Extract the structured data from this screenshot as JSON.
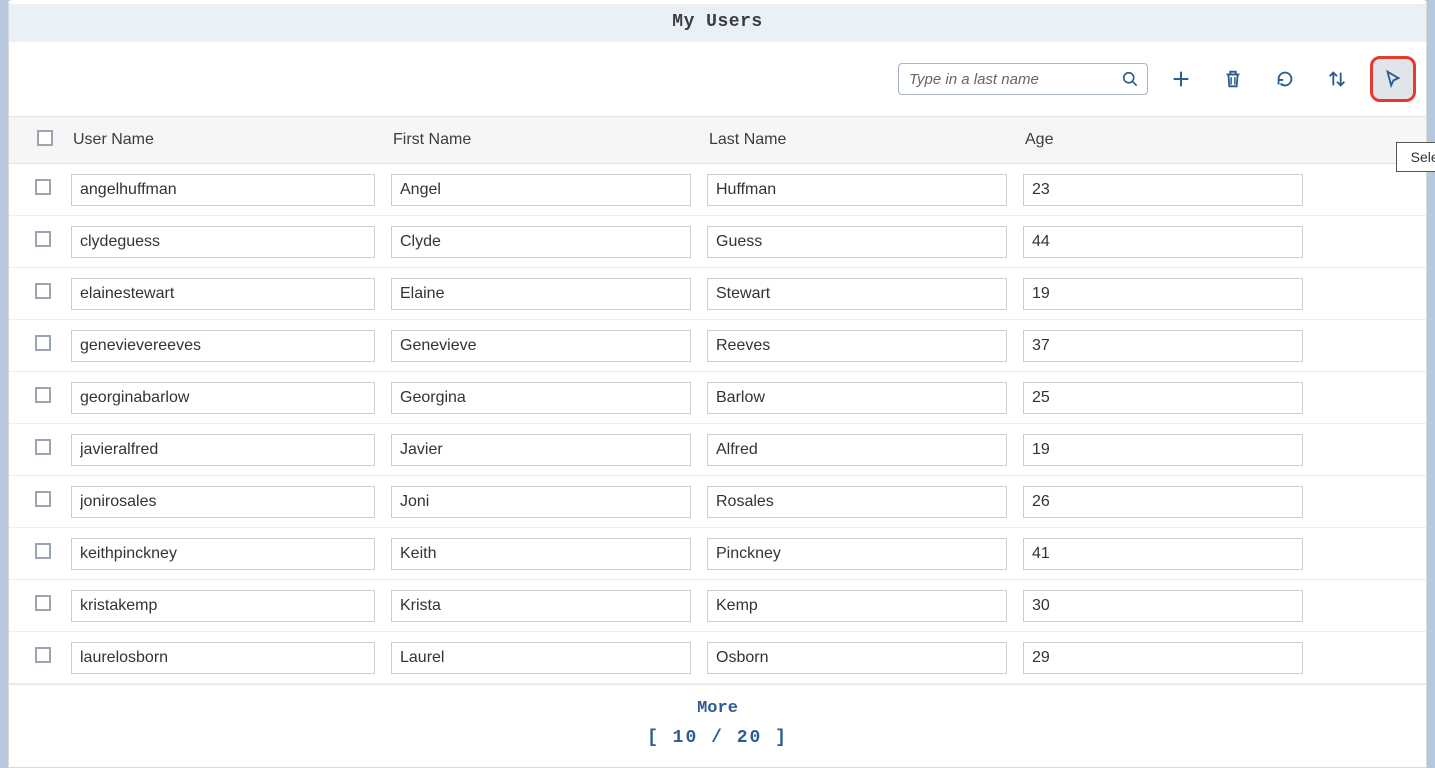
{
  "title": "My Users",
  "search": {
    "placeholder": "Type in a last name"
  },
  "tooltip": "Select User",
  "columns": {
    "userName": "User Name",
    "firstName": "First Name",
    "lastName": "Last Name",
    "age": "Age"
  },
  "rows": [
    {
      "userName": "angelhuffman",
      "firstName": "Angel",
      "lastName": "Huffman",
      "age": "23"
    },
    {
      "userName": "clydeguess",
      "firstName": "Clyde",
      "lastName": "Guess",
      "age": "44"
    },
    {
      "userName": "elainestewart",
      "firstName": "Elaine",
      "lastName": "Stewart",
      "age": "19"
    },
    {
      "userName": "genevievereeves",
      "firstName": "Genevieve",
      "lastName": "Reeves",
      "age": "37"
    },
    {
      "userName": "georginabarlow",
      "firstName": "Georgina",
      "lastName": "Barlow",
      "age": "25"
    },
    {
      "userName": "javieralfred",
      "firstName": "Javier",
      "lastName": "Alfred",
      "age": "19"
    },
    {
      "userName": "jonirosales",
      "firstName": "Joni",
      "lastName": "Rosales",
      "age": "26"
    },
    {
      "userName": "keithpinckney",
      "firstName": "Keith",
      "lastName": "Pinckney",
      "age": "41"
    },
    {
      "userName": "kristakemp",
      "firstName": "Krista",
      "lastName": "Kemp",
      "age": "30"
    },
    {
      "userName": "laurelosborn",
      "firstName": "Laurel",
      "lastName": "Osborn",
      "age": "29"
    }
  ],
  "footer": {
    "more": "More",
    "pager": "[ 10 / 20 ]"
  }
}
